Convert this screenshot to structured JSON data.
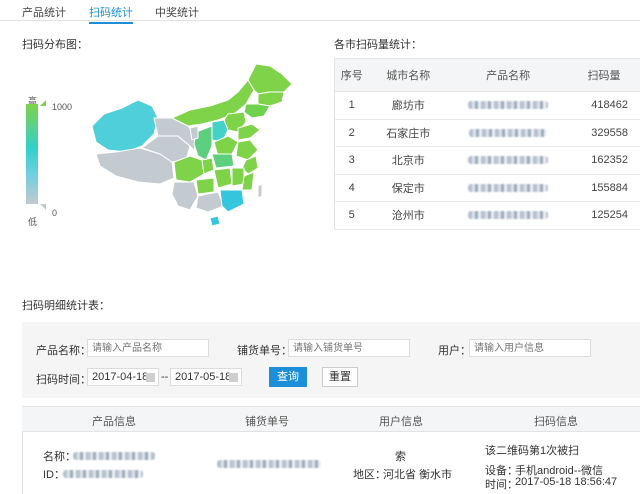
{
  "tabs": [
    {
      "label": "产品统计",
      "active": false
    },
    {
      "label": "扫码统计",
      "active": true
    },
    {
      "label": "中奖统计",
      "active": false
    }
  ],
  "map_section": {
    "title": "扫码分布图：",
    "legend": {
      "high_label": "高",
      "low_label": "低",
      "max_value": "1000",
      "min_value": "0"
    }
  },
  "ranking": {
    "title": "各市扫码量统计：",
    "columns": [
      "序号",
      "城市名称",
      "产品名称",
      "扫码量"
    ],
    "rows": [
      {
        "index": "1",
        "city": "廊坊市",
        "count": "418462"
      },
      {
        "index": "2",
        "city": "石家庄市",
        "count": "329558"
      },
      {
        "index": "3",
        "city": "北京市",
        "count": "162352"
      },
      {
        "index": "4",
        "city": "保定市",
        "count": "155884"
      },
      {
        "index": "5",
        "city": "沧州市",
        "count": "125254"
      }
    ]
  },
  "detail_section": {
    "title": "扫码明细统计表：",
    "search": {
      "product_label": "产品名称：",
      "product_placeholder": "请输入产品名称",
      "order_label": "铺货单号：",
      "order_placeholder": "请输入铺货单号",
      "user_label": "用户：",
      "user_placeholder": "请输入用户信息",
      "time_label": "扫码时间：",
      "date_from": "2017-04-18",
      "date_sep": "--",
      "date_to": "2017-05-18",
      "query_label": "查询",
      "reset_label": "重置"
    },
    "columns": [
      "产品信息",
      "铺货单号",
      "用户信息",
      "扫码信息"
    ],
    "row": {
      "name_label": "名称：",
      "id_label": "ID：",
      "user_name": "索",
      "region_label": "地区：",
      "region_value": "河北省 衡水市",
      "scan_line": "该二维码第1次被扫",
      "device_label": "设备：",
      "device_value": "手机android--微信",
      "time_label": "时间：",
      "time_value": "2017-05-18 18:56:47"
    }
  },
  "colors": {
    "accent": "#1d8fd8",
    "map_high": "#7ed348",
    "map_mid": "#33d0cc",
    "map_low": "#c2c9cf"
  }
}
